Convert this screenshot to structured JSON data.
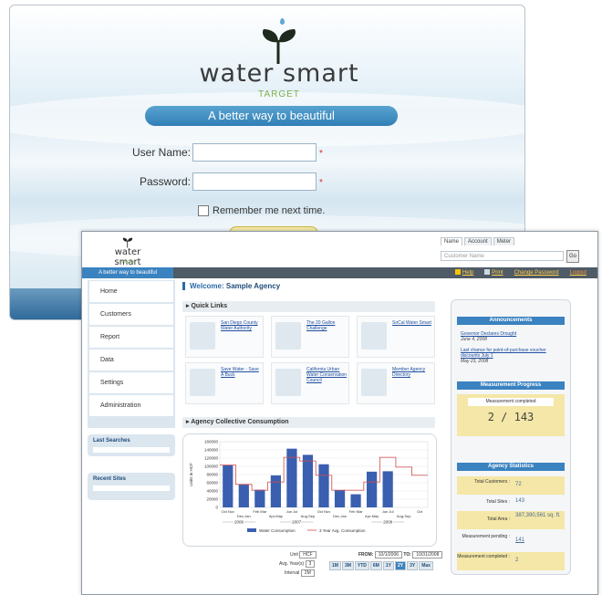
{
  "login": {
    "brand": "water smart",
    "brand_sub": "TARGET",
    "tagline": "A better way to beautiful",
    "username_label": "User Name:",
    "password_label": "Password:",
    "required_mark": "*",
    "remember_label": "Remember me next time."
  },
  "dash": {
    "brand": "water smart",
    "brand_sub": "TARGET",
    "tabs": [
      "Name",
      "Account",
      "Meter"
    ],
    "customer_placeholder": "Customer Name",
    "go_label": "Go",
    "bar_tagline": "A better way to beautiful",
    "bar_links": [
      "Help",
      "Print",
      "Change Password",
      "Logout"
    ],
    "nav": [
      "Home",
      "Customers",
      "Report",
      "Data",
      "Settings",
      "Administration"
    ],
    "last_searches": "Last Searches",
    "recent_sites": "Recent Sites",
    "welcome_prefix": "Welcome:",
    "welcome_name": "Sample Agency",
    "quick_links_title": "Quick Links",
    "quick_links": [
      "San Diego County Water Authority",
      "The 20 Gallon Challenge",
      "SoCal Water Smart",
      "Save Water - Save A Buck",
      "California Urban Water Conservation Council",
      "Member Agency Directory"
    ],
    "consumption_title": "Agency Collective Consumption",
    "controls": {
      "unit_label": "Unit",
      "unit_value": "HCF",
      "avg_label": "Avg. Year(s)",
      "avg_value": "3",
      "interval_label": "Interval",
      "interval_value": "2M",
      "from_label": "FROM:",
      "from_value": "10/1/2006",
      "to_label": "TO:",
      "to_value": "10/31/2008"
    },
    "range_buttons": [
      "1M",
      "3M",
      "YTD",
      "6M",
      "1Y",
      "2Y",
      "3Y",
      "Max"
    ],
    "range_selected": "2Y",
    "announcements_title": "Announcements",
    "announcements": [
      {
        "text": "Governor Declares Drought",
        "date": "June 4, 2008"
      },
      {
        "text": "Last chance for point-of-purchase voucher discounts July 1",
        "date": "May 23, 2008"
      }
    ],
    "progress_title": "Measurement Progress",
    "progress_caption": "Measurement completed",
    "progress_value": "2 / 143",
    "stats_title": "Agency Statistics",
    "stats": [
      {
        "label": "Total Customers :",
        "value": "72"
      },
      {
        "label": "Total Sites :",
        "value": "143"
      },
      {
        "label": "Total Area :",
        "value": "387,390,561 sq. ft."
      },
      {
        "label": "Measurement pending :",
        "value": "141"
      },
      {
        "label": "Measurement completed :",
        "value": "2"
      }
    ]
  },
  "chart_data": {
    "type": "bar",
    "ylabel": "Units in HCF",
    "ylim": [
      0,
      100000
    ],
    "yticks": [
      0,
      20000,
      40000,
      60000,
      80000,
      100000,
      120000,
      140000,
      160000
    ],
    "categories": [
      "Oct-Nov",
      "Dec-Jan",
      "Feb-Mar",
      "Apr-May",
      "Jun-Jul",
      "Aug-Sep",
      "Oct",
      "Dec-Jan",
      "Feb-Mar",
      "Apr-May",
      "Jun-Jul",
      "Aug-Sep",
      "Oct"
    ],
    "x_tick_labels": [
      "Oct Nov",
      "Dec-Jan",
      "Feb Mar",
      "Apr-May",
      "Jun Jul",
      "Aug-Sep",
      "Oct Nov",
      "Dec-Jan",
      "Feb Mar",
      "Apr-May",
      "Jun Jul",
      "Aug-Sep",
      "Oct"
    ],
    "year_labels": [
      "2006",
      "2007",
      "2008"
    ],
    "series": [
      {
        "name": "Water Consumption",
        "values": [
          103000,
          56000,
          43000,
          78000,
          143000,
          128000,
          105000,
          42000,
          32000,
          87000,
          88000,
          0,
          0
        ]
      },
      {
        "name": "3 Year Avg. Consumption",
        "values": [
          103000,
          56000,
          42000,
          62000,
          122000,
          113000,
          78000,
          42000,
          42000,
          62000,
          122000,
          98000,
          78000
        ]
      }
    ],
    "colors": {
      "bars": "#3a5fb0",
      "avg_line": "#d64a4a"
    }
  }
}
